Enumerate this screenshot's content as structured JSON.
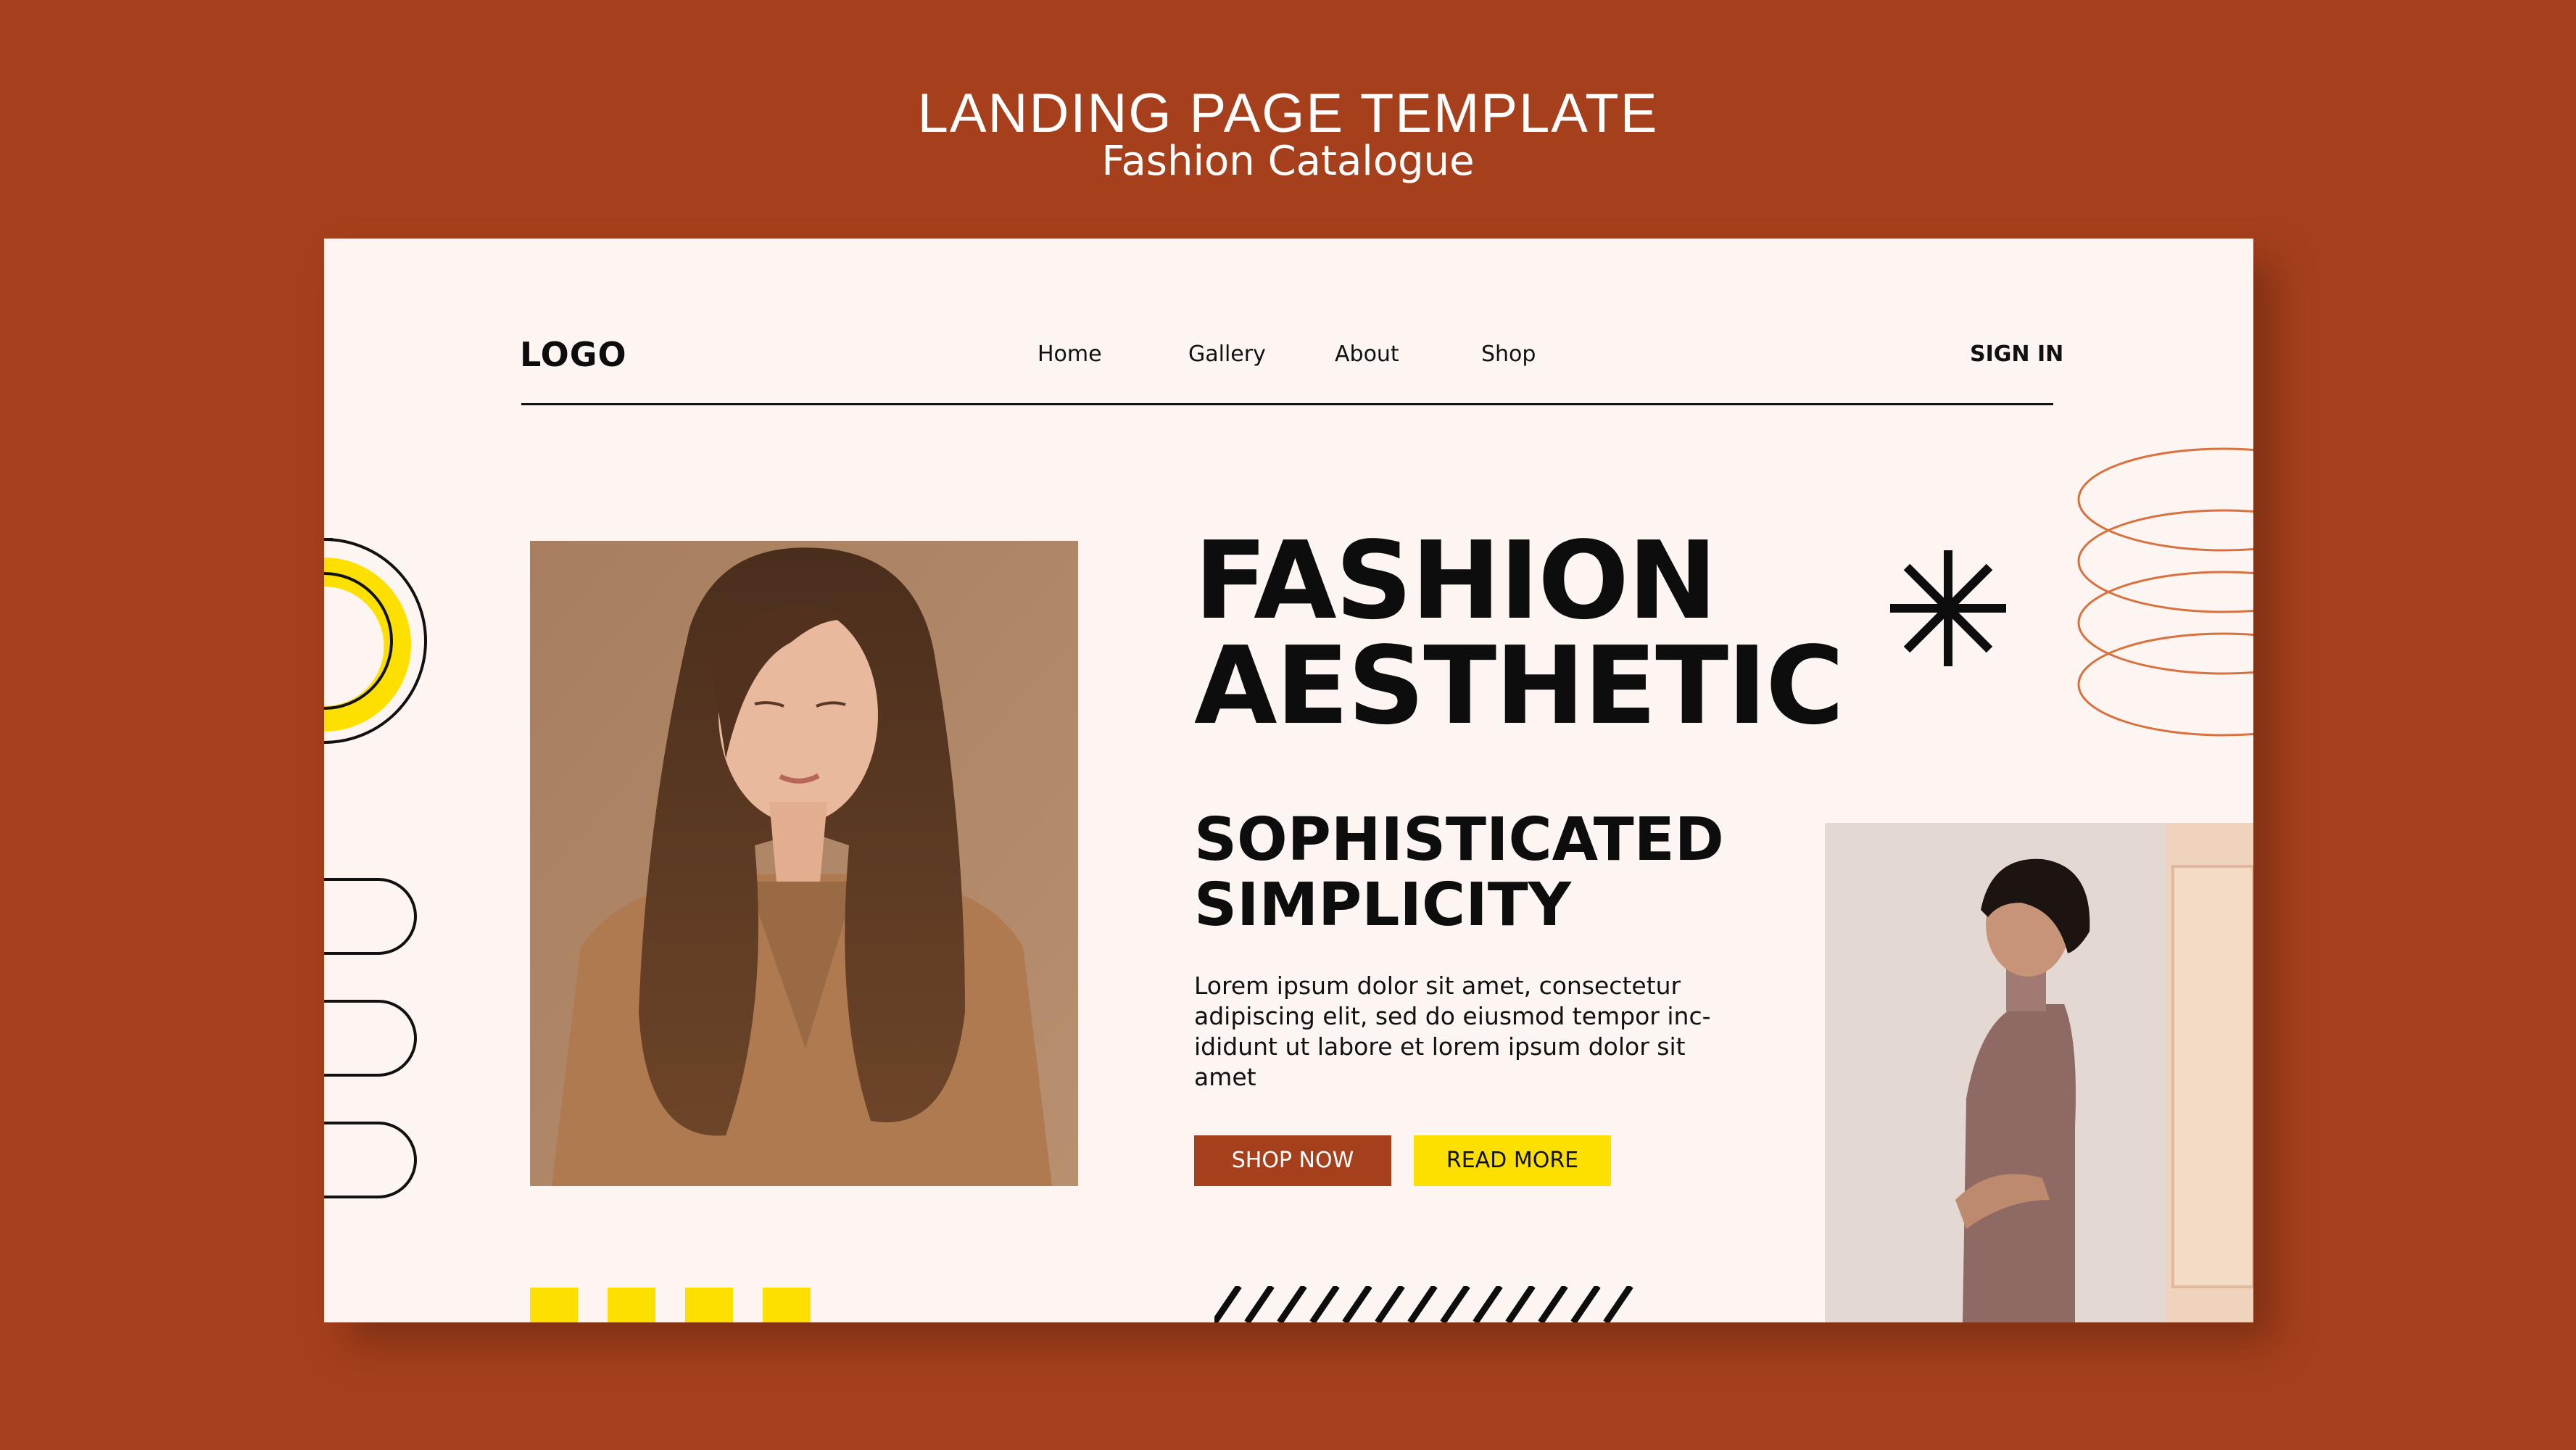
{
  "header": {
    "title": "LANDING PAGE TEMPLATE",
    "subtitle": "Fashion Catalogue"
  },
  "nav": {
    "logo": "LOGO",
    "links": [
      "Home",
      "Gallery",
      "About",
      "Shop"
    ],
    "signin": "SIGN IN"
  },
  "hero": {
    "headline_line1": "FASHION",
    "headline_line2": "AESTHETIC",
    "subheadline_line1": "SOPHISTICATED",
    "subheadline_line2": "SIMPLICITY",
    "body_lines": [
      "Lorem ipsum dolor sit amet, consectetur",
      "adipiscing elit, sed do eiusmod tempor inc-",
      "ididunt ut labore et lorem ipsum dolor sit",
      "amet"
    ],
    "shop_button": "SHOP NOW",
    "read_button": "READ MORE"
  },
  "colors": {
    "background": "#a6401c",
    "card": "#fdf5f2",
    "accent_yellow": "#fde000",
    "accent_rust": "#a6401c",
    "ring_orange": "#d9713f",
    "text": "#0d0d0d"
  },
  "icons": [
    "asterisk-icon"
  ]
}
